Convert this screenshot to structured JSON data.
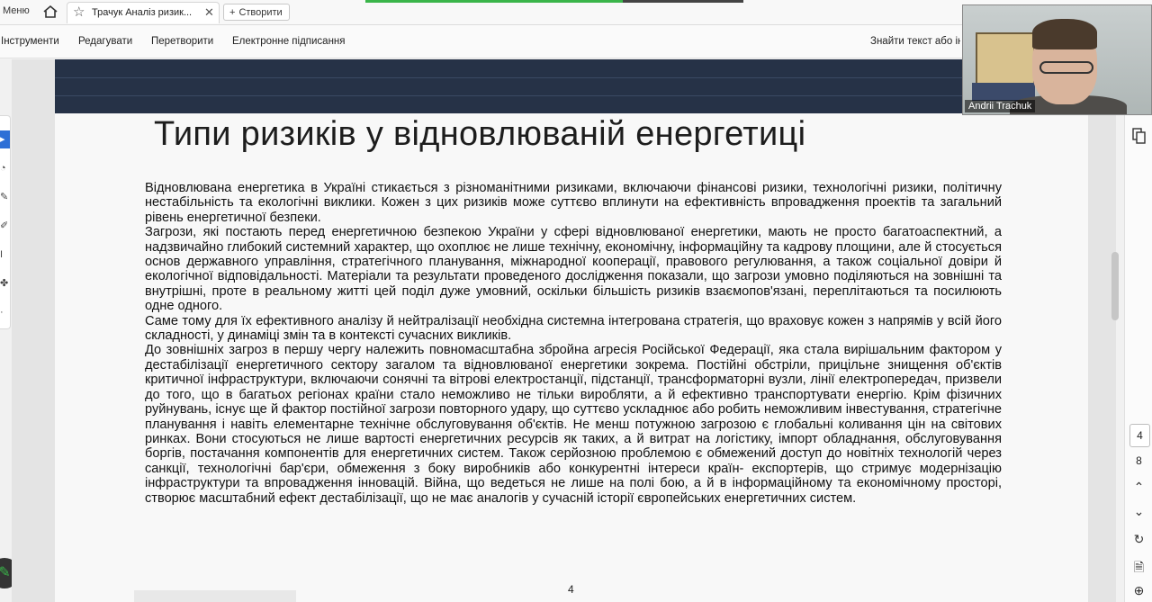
{
  "tabbar": {
    "menu_label": "Меню",
    "doc_tab_title": "Трачук Аналіз ризик...",
    "create_label": "Створити",
    "progress_fraction": 0.68
  },
  "toolbar": {
    "items": [
      "Інструменти",
      "Редагувати",
      "Перетворити",
      "Електронне підписання"
    ],
    "find_label": "Знайти текст або ін"
  },
  "video": {
    "participant_name": "Andrii Trachuk"
  },
  "slide": {
    "title": "Типи ризиків у відновлюваній енергетиці",
    "paragraphs": [
      "Відновлювана енергетика в Україні стикається з різноманітними ризиками, включаючи фінансові ризики, технологічні ризики, політичну нестабільність та екологічні виклики. Кожен з цих ризиків може суттєво вплинути на ефективність впровадження проектів та загальний рівень енергетичної безпеки.",
      "Загрози, які постають перед енергетичною  безпекою України у сфері відновлюваної енергетики, мають не просто багатоаспектний, а надзвичайно глибокий системний характер, що охоплює не лише технічну, економічну, інформаційну та кадрову площини, але й стосується основ державного управління, стратегічного планування, міжнародної кооперації, правового регулювання, а також соціальної довіри й екологічної відповідальності. Матеріали та результати проведеного дослідження показали, що загрози умовно поділяються на зовнішні та внутрішні, проте в реальному житті цей поділ дуже умовний, оскільки більшість ризиків взаємопов'язані, переплітаються та посилюють одне одного.",
      " Саме тому для їх ефективного аналізу й нейтралізації необхідна системна інтегрована стратегія, що враховує кожен з напрямів у всій його складності, у динаміці змін та в контексті сучасних викликів.",
      "До зовнішніх загроз в першу чергу належить повномасштабна збройна агресія Російської Федерації, яка стала вирішальним фактором у дестабілізації енергетичного сектору загалом та відновлюваної енергетики зокрема. Постійні обстріли, прицільне знищення об'єктів критичної інфраструктури, включаючи сонячні та вітрові електростанції, підстанції, трансформаторні вузли, лінії електропередач, призвели до того, що в багатьох регіонах країни стало неможливо не тільки виробляти, а й ефективно транспортувати енергію. Крім фізичних руйнувань, існує ще й фактор постійної загрози повторного удару, що суттєво ускладнює або робить неможливим інвестування, стратегічне планування і навіть елементарне технічне обслуговування об'єктів. Не менш потужною загрозою є глобальні коливання цін на світових ринках. Вони стосуються не лише вартості енергетичних ресурсів як таких, а й витрат на логістику, імпорт обладнання, обслуговування боргів, постачання компонентів для енергетичних систем. Також серйозною проблемою є обмежений доступ до новітніх технологій через санкції, технологічні бар'єри, обмеження з боку виробників або конкурентні інтереси країн- експортерів, що стримує модернізацію інфраструктури та впровадження  інновацій. Війна, що ведеться не лише на полі бою, а й в інформаційному та економічному просторі, створює масштабний ефект дестабілізації, що не має аналогів у сучасній історії європейських енергетичних систем."
    ],
    "page_number": "4"
  },
  "navigation": {
    "current_page": "4",
    "total_pages": "8"
  }
}
